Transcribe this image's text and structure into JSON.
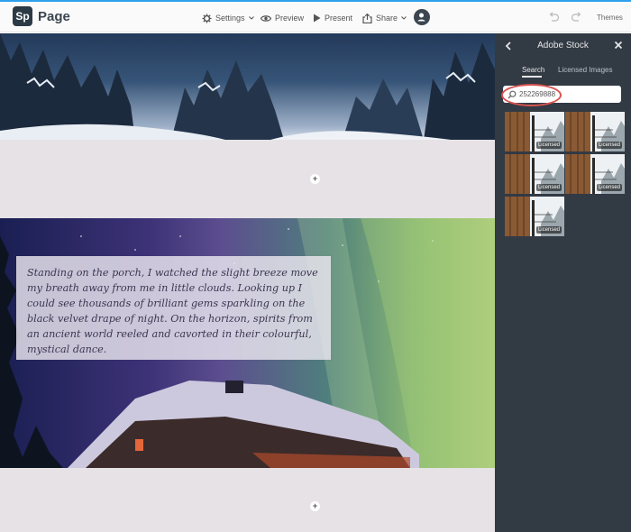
{
  "app": {
    "badge": "Sp",
    "name": "Page"
  },
  "toolbar": {
    "settings": "Settings",
    "preview": "Preview",
    "present": "Present",
    "share": "Share",
    "themes": "Themes"
  },
  "canvas": {
    "quote": "Standing on the porch, I watched the slight breeze move my breath away from me in little clouds. Looking up I could see thousands of brilliant gems sparkling on the black velvet drape of night. On the horizon, spirits from an ancient world reeled and cavorted in their colourful, mystical dance."
  },
  "panel": {
    "title": "Adobe Stock",
    "tabs": [
      "Search",
      "Licensed Images"
    ],
    "search_value": "252269888",
    "thumb_badge": "Licensed"
  },
  "colors": {
    "accent": "#2da0ee",
    "panel_bg": "#323a44",
    "highlight": "#d9534f"
  }
}
